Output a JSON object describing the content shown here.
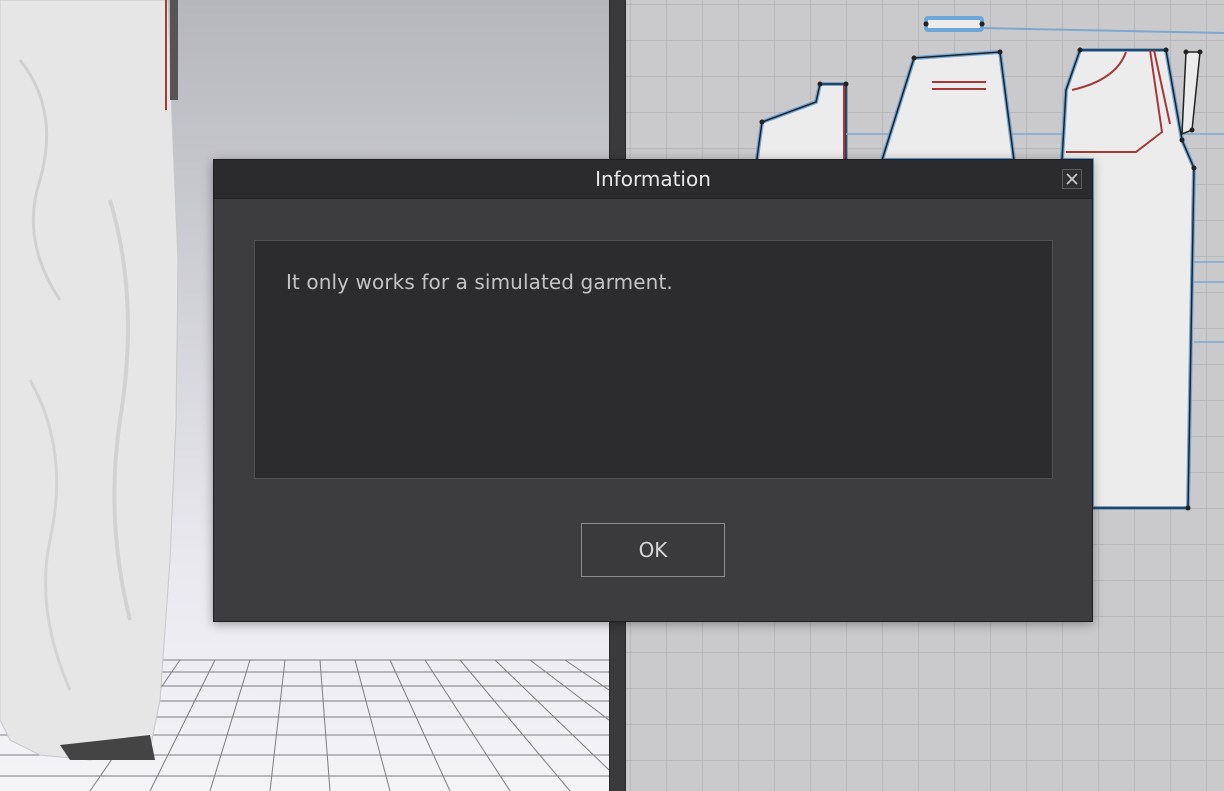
{
  "dialog": {
    "title": "Information",
    "message": "It only works for a simulated garment.",
    "ok_label": "OK",
    "close_icon": "close-icon"
  },
  "panes": {
    "left": "3d-garment-viewport",
    "right": "2d-pattern-window"
  },
  "colors": {
    "dialog_bg": "#3d3d40",
    "titlebar_bg": "#2b2b2d",
    "message_bg": "#2c2c2e",
    "pattern_outline": "#6fa6d8",
    "seam_red": "#a33a3a",
    "grid_bg": "#cacacc"
  }
}
